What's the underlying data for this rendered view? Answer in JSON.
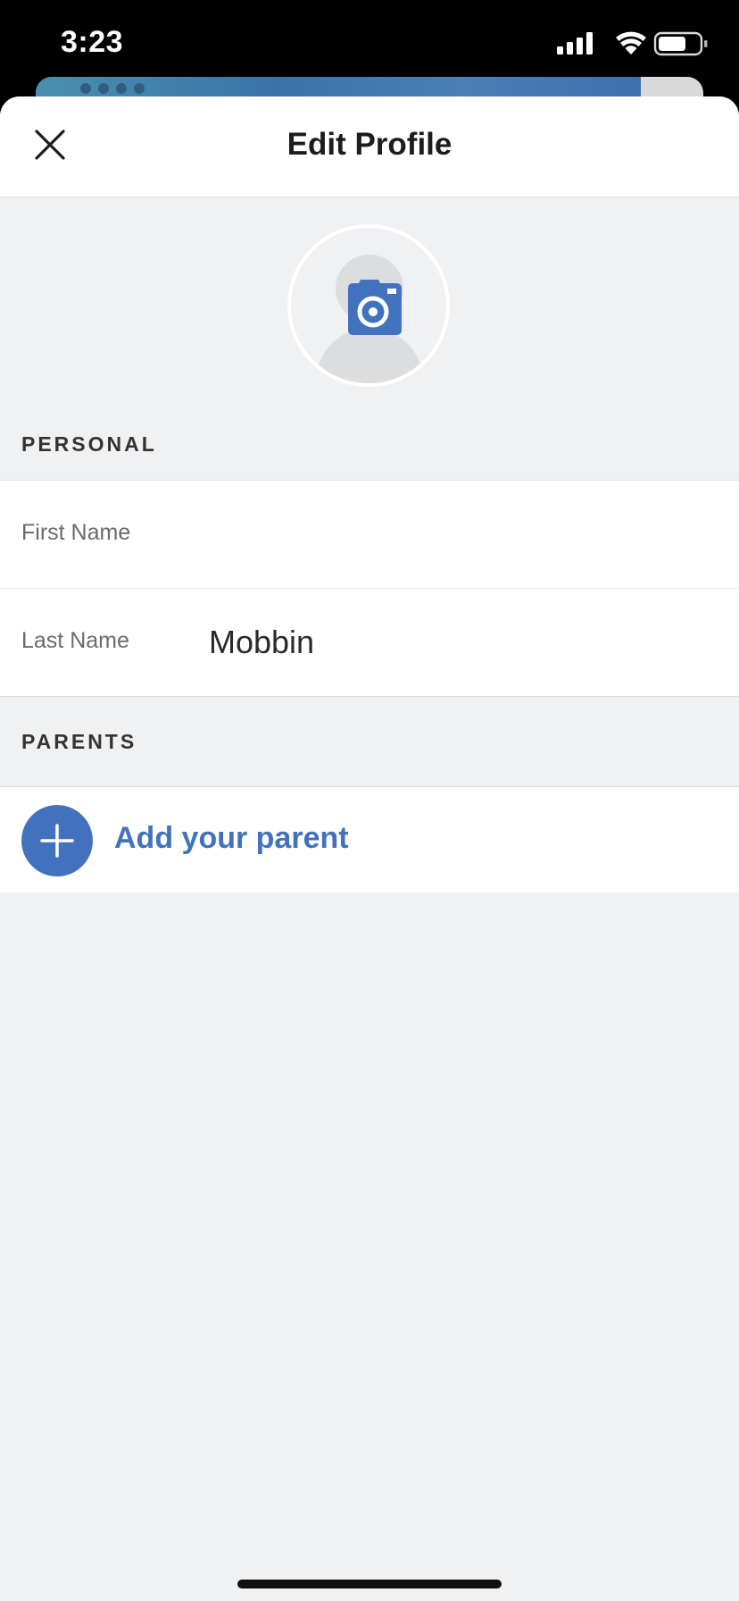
{
  "status_bar": {
    "time": "3:23"
  },
  "header": {
    "title": "Edit Profile",
    "close_icon": "close-icon"
  },
  "avatar": {
    "icon": "camera-icon",
    "accent_color": "#4272bd"
  },
  "personal": {
    "section_label": "PERSONAL",
    "first_name": {
      "label": "First Name",
      "value": "",
      "placeholder": ""
    },
    "last_name": {
      "label": "Last Name",
      "value": "Mobbin"
    }
  },
  "parents": {
    "section_label": "PARENTS",
    "add_label": "Add your parent",
    "add_icon": "plus-icon"
  },
  "colors": {
    "accent": "#4272bd",
    "background": "#f0f1f3"
  }
}
